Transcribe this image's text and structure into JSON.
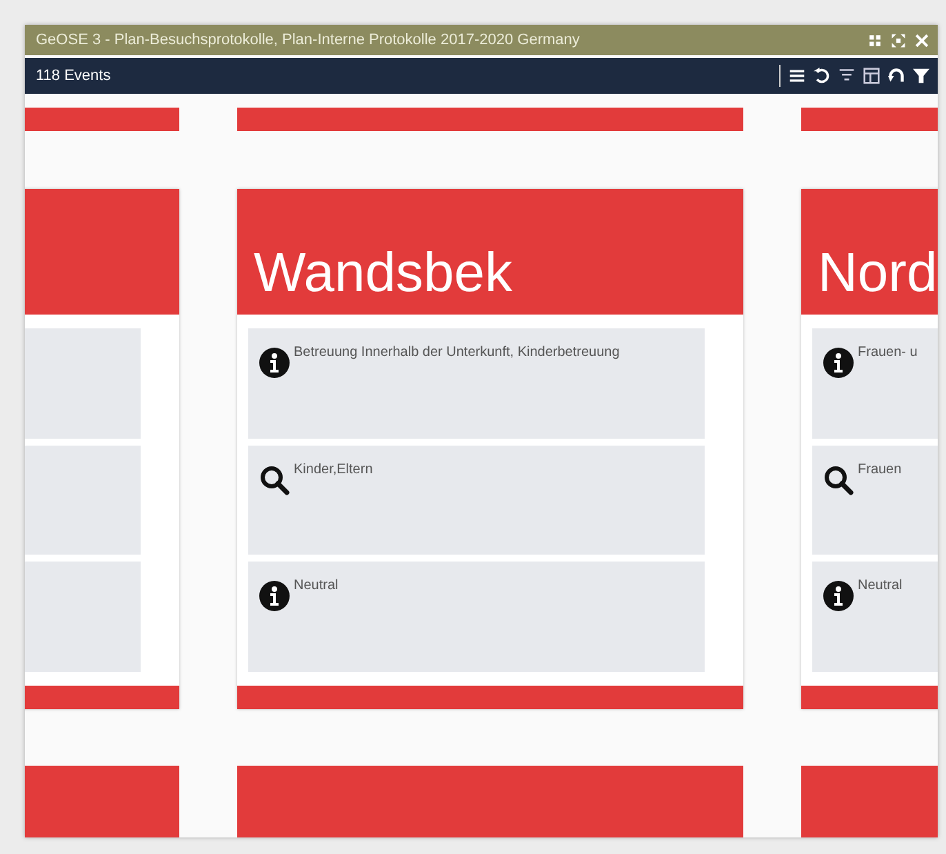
{
  "window": {
    "title": "GeOSE 3 - Plan-Besuchsprotokolle, Plan-Interne Protokolle 2017-2020 Germany"
  },
  "toolbar": {
    "count": "118 Events"
  },
  "columns": [
    {
      "items": [
        {
          "kind": "blank"
        },
        {
          "kind": "blank"
        },
        {
          "kind": "blank"
        }
      ]
    },
    {
      "title": "Wandsbek",
      "items": [
        {
          "kind": "info",
          "text": "Betreuung Innerhalb der Unterkunft, Kinderbetreuung"
        },
        {
          "kind": "search",
          "text": "Kinder,Eltern"
        },
        {
          "kind": "info",
          "text": "Neutral"
        }
      ]
    },
    {
      "title": "Nord",
      "items": [
        {
          "kind": "info",
          "text": "Frauen- u"
        },
        {
          "kind": "search",
          "text": "Frauen"
        },
        {
          "kind": "info",
          "text": "Neutral"
        }
      ]
    }
  ]
}
